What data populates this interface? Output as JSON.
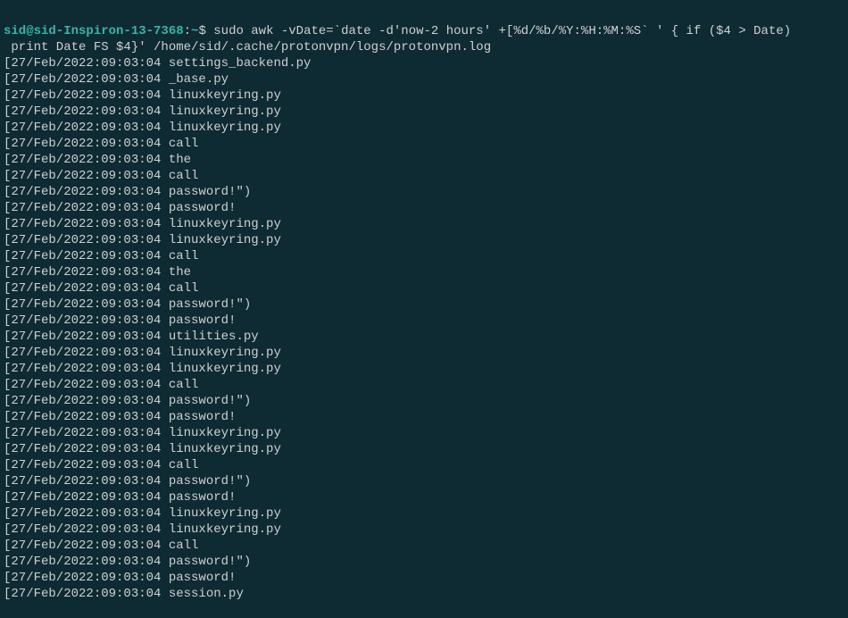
{
  "prompt": {
    "userHost": "sid@sid-Inspiron-13-7368",
    "separator": ":",
    "path": "~",
    "symbol": "$"
  },
  "command": {
    "line1": " sudo awk -vDate=`date -d'now-2 hours' +[%d/%b/%Y:%H:%M:%S` ' { if ($4 > Date)",
    "line2": " print Date FS $4}' /home/sid/.cache/protonvpn/logs/protonvpn.log"
  },
  "logLines": [
    "[27/Feb/2022:09:03:04 settings_backend.py",
    "[27/Feb/2022:09:03:04 _base.py",
    "[27/Feb/2022:09:03:04 linuxkeyring.py",
    "[27/Feb/2022:09:03:04 linuxkeyring.py",
    "[27/Feb/2022:09:03:04 linuxkeyring.py",
    "[27/Feb/2022:09:03:04 call",
    "[27/Feb/2022:09:03:04 the",
    "[27/Feb/2022:09:03:04 call",
    "[27/Feb/2022:09:03:04 password!\")",
    "[27/Feb/2022:09:03:04 password!",
    "[27/Feb/2022:09:03:04 linuxkeyring.py",
    "[27/Feb/2022:09:03:04 linuxkeyring.py",
    "[27/Feb/2022:09:03:04 call",
    "[27/Feb/2022:09:03:04 the",
    "[27/Feb/2022:09:03:04 call",
    "[27/Feb/2022:09:03:04 password!\")",
    "[27/Feb/2022:09:03:04 password!",
    "[27/Feb/2022:09:03:04 utilities.py",
    "[27/Feb/2022:09:03:04 linuxkeyring.py",
    "[27/Feb/2022:09:03:04 linuxkeyring.py",
    "[27/Feb/2022:09:03:04 call",
    "[27/Feb/2022:09:03:04 password!\")",
    "[27/Feb/2022:09:03:04 password!",
    "[27/Feb/2022:09:03:04 linuxkeyring.py",
    "[27/Feb/2022:09:03:04 linuxkeyring.py",
    "[27/Feb/2022:09:03:04 call",
    "[27/Feb/2022:09:03:04 password!\")",
    "[27/Feb/2022:09:03:04 password!",
    "[27/Feb/2022:09:03:04 linuxkeyring.py",
    "[27/Feb/2022:09:03:04 linuxkeyring.py",
    "[27/Feb/2022:09:03:04 call",
    "[27/Feb/2022:09:03:04 password!\")",
    "[27/Feb/2022:09:03:04 password!",
    "[27/Feb/2022:09:03:04 session.py"
  ]
}
